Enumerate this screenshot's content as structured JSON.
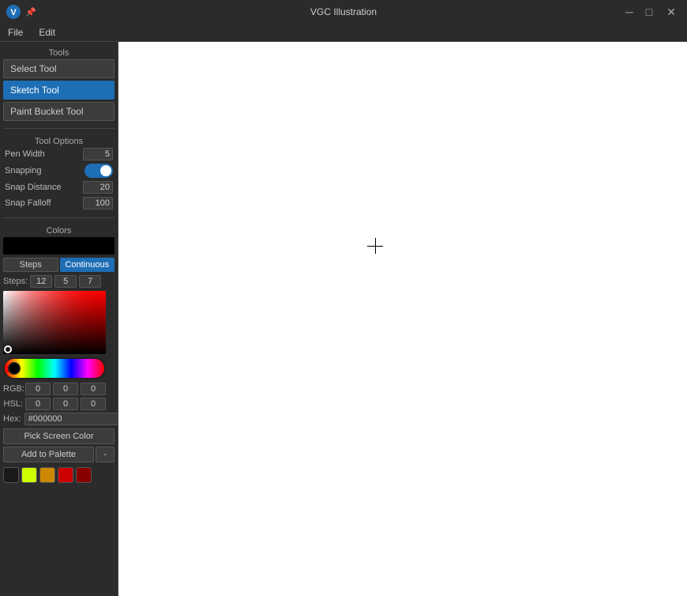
{
  "app": {
    "title": "VGC Illustration",
    "logo": "V"
  },
  "titlebar": {
    "minimize_label": "─",
    "maximize_label": "□",
    "close_label": "✕"
  },
  "menubar": {
    "items": [
      {
        "label": "File"
      },
      {
        "label": "Edit"
      }
    ]
  },
  "sidebar": {
    "tools_label": "Tools",
    "tools": [
      {
        "id": "select",
        "label": "Select Tool",
        "active": false
      },
      {
        "id": "sketch",
        "label": "Sketch Tool",
        "active": true
      },
      {
        "id": "paint",
        "label": "Paint Bucket Tool",
        "active": false
      }
    ],
    "tool_options_label": "Tool Options",
    "pen_width_label": "Pen Width",
    "pen_width_value": "5",
    "snapping_label": "Snapping",
    "snapping_on": true,
    "snap_distance_label": "Snap Distance",
    "snap_distance_value": "20",
    "snap_falloff_label": "Snap Falloff",
    "snap_falloff_value": "100",
    "colors_label": "Colors",
    "mode_steps": "Steps",
    "mode_continuous": "Continuous",
    "steps_label": "Steps:",
    "step1": "12",
    "step2": "5",
    "step3": "7",
    "rgb_label": "RGB:",
    "rgb_r": "0",
    "rgb_g": "0",
    "rgb_b": "0",
    "hsl_label": "HSL:",
    "hsl_h": "0",
    "hsl_s": "0",
    "hsl_l": "0",
    "hex_label": "Hex:",
    "hex_value": "#000000",
    "pick_screen_label": "Pick Screen Color",
    "add_palette_label": "Add to Palette",
    "add_palette_minus": "-",
    "palette": [
      {
        "color": "#1a1a1a"
      },
      {
        "color": "#ccff00"
      },
      {
        "color": "#cc8800"
      },
      {
        "color": "#cc0000"
      },
      {
        "color": "#880000"
      }
    ]
  }
}
